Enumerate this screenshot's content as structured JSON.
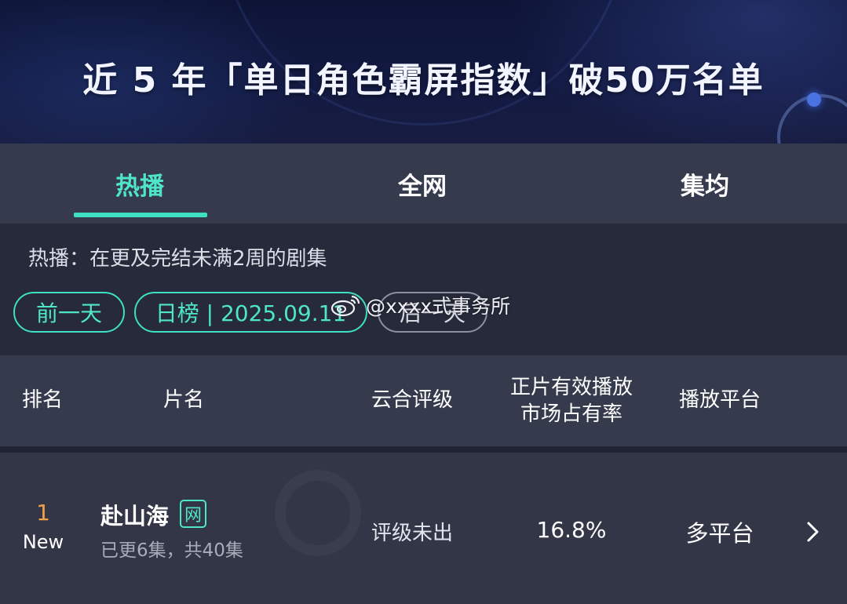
{
  "banner": {
    "title": "近 5 年「单日角色霸屏指数」破50万名单"
  },
  "tabs": [
    {
      "label": "热播",
      "active": true
    },
    {
      "label": "全网",
      "active": false
    },
    {
      "label": "集均",
      "active": false
    }
  ],
  "filter": {
    "description": "热播：在更及完结未满2周的剧集",
    "prev_label": "前一天",
    "date_label": "日榜 | 2025.09.11",
    "next_label": "后一天"
  },
  "watermark": {
    "text": "@xxxx式事务所",
    "icon": "weibo-icon"
  },
  "table": {
    "headers": {
      "rank": "排名",
      "name": "片名",
      "rating": "云合评级",
      "share_line1": "正片有效播放",
      "share_line2": "市场占有率",
      "platform": "播放平台"
    },
    "rows": [
      {
        "rank": "1",
        "status": "New",
        "title": "赴山海",
        "badge": "网",
        "episodes": "已更6集，共40集",
        "rating": "评级未出",
        "share": "16.8%",
        "platform": "多平台"
      }
    ]
  },
  "colors": {
    "accent": "#3fe0c2",
    "rank": "#f0a04a",
    "tab_bg": "#353a4c",
    "page_bg": "#262a3a"
  }
}
